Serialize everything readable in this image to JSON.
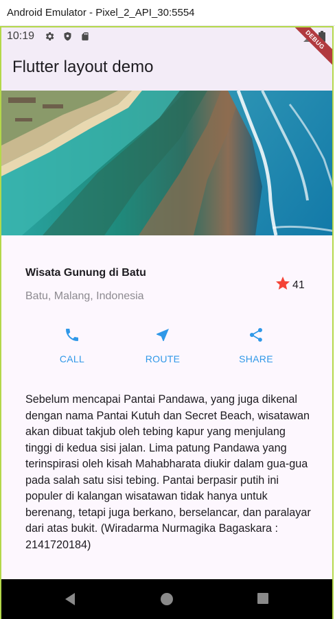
{
  "window": {
    "title": "Android Emulator - Pixel_2_API_30:5554"
  },
  "status_bar": {
    "time": "10:19"
  },
  "app_bar": {
    "title": "Flutter layout demo",
    "debug_banner": "DEBUG"
  },
  "place": {
    "name": "Wisata Gunung di Batu",
    "location": "Batu, Malang, Indonesia",
    "rating_count": "41"
  },
  "actions": [
    {
      "label": "CALL",
      "icon": "call-icon"
    },
    {
      "label": "ROUTE",
      "icon": "near-me-icon"
    },
    {
      "label": "SHARE",
      "icon": "share-icon"
    }
  ],
  "description": "Sebelum mencapai Pantai Pandawa, yang juga dikenal dengan nama Pantai Kutuh dan Secret Beach, wisatawan akan dibuat takjub oleh tebing kapur yang menjulang tinggi di kedua sisi jalan. Lima patung Pandawa yang terinspirasi oleh kisah Mahabharata diukir dalam gua-gua pada salah satu sisi tebing. Pantai berpasir putih ini populer di kalangan wisatawan tidak hanya untuk berenang, tetapi juga berkano, berselancar, dan paralayar dari atas bukit. (Wiradarma Nurmagika Bagaskara : 2141720184)",
  "colors": {
    "accent": "#2f98e8",
    "star": "#f44336",
    "app_bar_bg": "#f3ecf7",
    "body_bg": "#fdf7fe",
    "debug_banner": "#b13a3f"
  }
}
